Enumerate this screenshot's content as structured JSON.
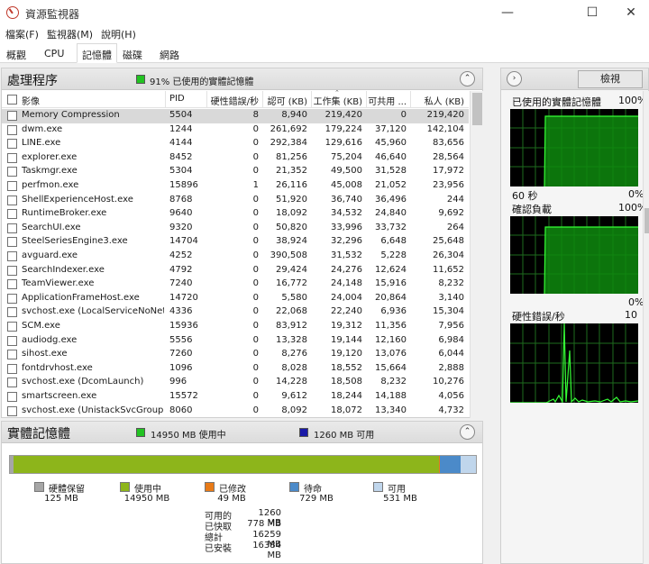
{
  "window": {
    "title": "資源監視器",
    "minimize": "—",
    "maximize": "☐",
    "close": "✕"
  },
  "menu": [
    "檔案(F)",
    "監視器(M)",
    "說明(H)"
  ],
  "tabs": [
    "概觀",
    "CPU",
    "記憶體",
    "磁碟",
    "網路"
  ],
  "processes": {
    "title": "處理程序",
    "status_text": "91% 已使用的實體記憶體",
    "status_color": "#22c322",
    "columns": [
      "影像",
      "PID",
      "硬性錯誤/秒",
      "認可 (KB)",
      "工作集 (KB)",
      "可共用 ...",
      "私人 (KB)"
    ],
    "rows": [
      {
        "name": "Memory Compression",
        "pid": "5504",
        "hard": "8",
        "commit": "8,940",
        "ws": "219,420",
        "share": "0",
        "priv": "219,420"
      },
      {
        "name": "dwm.exe",
        "pid": "1244",
        "hard": "0",
        "commit": "261,692",
        "ws": "179,224",
        "share": "37,120",
        "priv": "142,104"
      },
      {
        "name": "LINE.exe",
        "pid": "4144",
        "hard": "0",
        "commit": "292,384",
        "ws": "129,616",
        "share": "45,960",
        "priv": "83,656"
      },
      {
        "name": "explorer.exe",
        "pid": "8452",
        "hard": "0",
        "commit": "81,256",
        "ws": "75,204",
        "share": "46,640",
        "priv": "28,564"
      },
      {
        "name": "Taskmgr.exe",
        "pid": "5304",
        "hard": "0",
        "commit": "21,352",
        "ws": "49,500",
        "share": "31,528",
        "priv": "17,972"
      },
      {
        "name": "perfmon.exe",
        "pid": "15896",
        "hard": "1",
        "commit": "26,116",
        "ws": "45,008",
        "share": "21,052",
        "priv": "23,956"
      },
      {
        "name": "ShellExperienceHost.exe",
        "pid": "8768",
        "hard": "0",
        "commit": "51,920",
        "ws": "36,740",
        "share": "36,496",
        "priv": "244"
      },
      {
        "name": "RuntimeBroker.exe",
        "pid": "9640",
        "hard": "0",
        "commit": "18,092",
        "ws": "34,532",
        "share": "24,840",
        "priv": "9,692"
      },
      {
        "name": "SearchUI.exe",
        "pid": "9320",
        "hard": "0",
        "commit": "50,820",
        "ws": "33,996",
        "share": "33,732",
        "priv": "264"
      },
      {
        "name": "SteelSeriesEngine3.exe",
        "pid": "14704",
        "hard": "0",
        "commit": "38,924",
        "ws": "32,296",
        "share": "6,648",
        "priv": "25,648"
      },
      {
        "name": "avguard.exe",
        "pid": "4252",
        "hard": "0",
        "commit": "390,508",
        "ws": "31,532",
        "share": "5,228",
        "priv": "26,304"
      },
      {
        "name": "SearchIndexer.exe",
        "pid": "4792",
        "hard": "0",
        "commit": "29,424",
        "ws": "24,276",
        "share": "12,624",
        "priv": "11,652"
      },
      {
        "name": "TeamViewer.exe",
        "pid": "7240",
        "hard": "0",
        "commit": "16,772",
        "ws": "24,148",
        "share": "15,916",
        "priv": "8,232"
      },
      {
        "name": "ApplicationFrameHost.exe",
        "pid": "14720",
        "hard": "0",
        "commit": "5,580",
        "ws": "24,004",
        "share": "20,864",
        "priv": "3,140"
      },
      {
        "name": "svchost.exe (LocalServiceNoNetwo...",
        "pid": "4336",
        "hard": "0",
        "commit": "22,068",
        "ws": "22,240",
        "share": "6,936",
        "priv": "15,304"
      },
      {
        "name": "SCM.exe",
        "pid": "15936",
        "hard": "0",
        "commit": "83,912",
        "ws": "19,312",
        "share": "11,356",
        "priv": "7,956"
      },
      {
        "name": "audiodg.exe",
        "pid": "5556",
        "hard": "0",
        "commit": "13,328",
        "ws": "19,144",
        "share": "12,160",
        "priv": "6,984"
      },
      {
        "name": "sihost.exe",
        "pid": "7260",
        "hard": "0",
        "commit": "8,276",
        "ws": "19,120",
        "share": "13,076",
        "priv": "6,044"
      },
      {
        "name": "fontdrvhost.exe",
        "pid": "1096",
        "hard": "0",
        "commit": "8,028",
        "ws": "18,552",
        "share": "15,664",
        "priv": "2,888"
      },
      {
        "name": "svchost.exe (DcomLaunch)",
        "pid": "996",
        "hard": "0",
        "commit": "14,228",
        "ws": "18,508",
        "share": "8,232",
        "priv": "10,276"
      },
      {
        "name": "smartscreen.exe",
        "pid": "15572",
        "hard": "0",
        "commit": "9,612",
        "ws": "18,244",
        "share": "14,188",
        "priv": "4,056"
      },
      {
        "name": "svchost.exe (UnistackSvcGroup)",
        "pid": "8060",
        "hard": "0",
        "commit": "8,092",
        "ws": "18,072",
        "share": "13,340",
        "priv": "4,732"
      }
    ]
  },
  "physical": {
    "title": "實體記憶體",
    "in_use_text": "14950 MB 使用中",
    "in_use_color": "#22c322",
    "available_text": "1260 MB 可用",
    "available_color": "#1a1aa8",
    "segments": [
      {
        "name": "硬體保留",
        "value": "125 MB",
        "mb": 125,
        "color": "#a6a6a6"
      },
      {
        "name": "使用中",
        "value": "14950 MB",
        "mb": 14950,
        "color": "#8db51b"
      },
      {
        "name": "已修改",
        "value": "49 MB",
        "mb": 49,
        "color": "#e87a17"
      },
      {
        "name": "待命",
        "value": "729 MB",
        "mb": 729,
        "color": "#4b8ac9"
      },
      {
        "name": "可用",
        "value": "531 MB",
        "mb": 531,
        "color": "#c0d6ec"
      }
    ],
    "summary": [
      {
        "label": "可用的",
        "value": "1260 MB"
      },
      {
        "label": "已快取",
        "value": "778 MB"
      },
      {
        "label": "總計",
        "value": "16259 MB"
      },
      {
        "label": "已安裝",
        "value": "16384 MB"
      }
    ]
  },
  "side": {
    "view_label": "檢視",
    "graph1_label": "已使用的實體記憶體",
    "graph1_pct": "100%",
    "graph1_time": "60 秒",
    "graph1_zero": "0%",
    "graph2_label": "確認負載",
    "graph2_pct": "100%",
    "graph2_zero": "0%",
    "graph3_label": "硬性錯誤/秒",
    "graph3_max": "10"
  }
}
